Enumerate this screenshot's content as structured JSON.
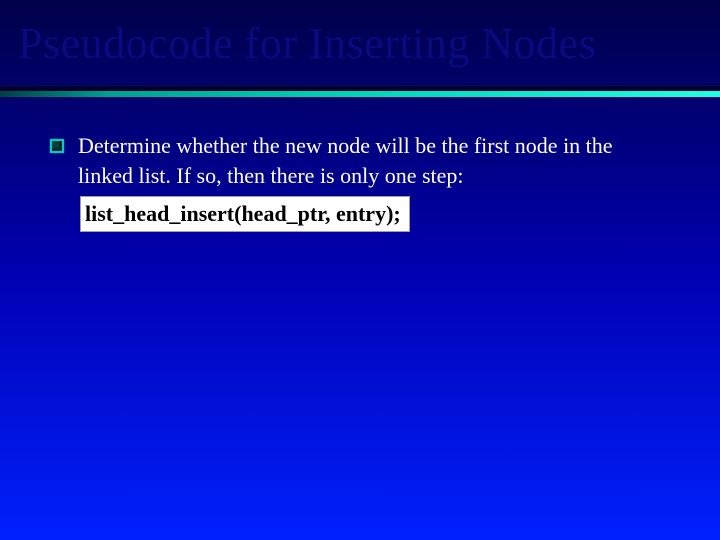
{
  "slide": {
    "title": "Pseudocode for Inserting Nodes",
    "bullets": [
      {
        "text": "Determine whether the new node will be the first node in the linked list.  If so, then there is only one step:",
        "code": "list_head_insert(head_ptr, entry);"
      }
    ]
  }
}
